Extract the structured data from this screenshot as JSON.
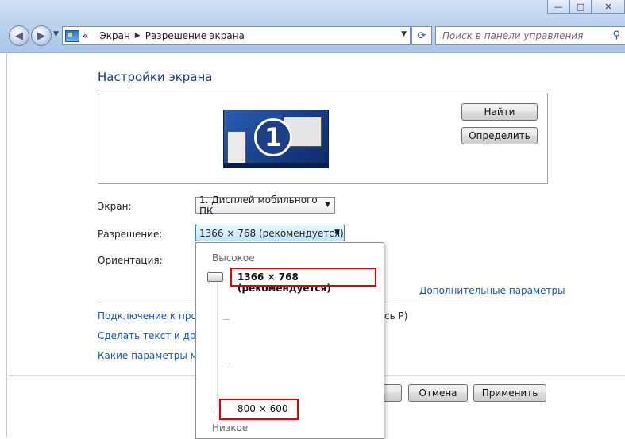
{
  "window": {
    "minimize": "—",
    "maximize": "□",
    "close": "✕"
  },
  "nav": {
    "back_icon": "back-arrow-icon",
    "forward_icon": "forward-arrow-icon"
  },
  "address": {
    "prefix": "«",
    "crumbs": [
      "Экран",
      "Разрешение экрана"
    ]
  },
  "search": {
    "placeholder": "Поиск в панели управления"
  },
  "page": {
    "title": "Настройки экрана"
  },
  "preview": {
    "monitor_number": "1"
  },
  "buttons": {
    "find": "Найти",
    "identify": "Определить",
    "cancel": "Отмена",
    "apply": "Применить"
  },
  "form": {
    "screen_label": "Экран:",
    "screen_value": "1. Дисплей мобильного ПК",
    "resolution_label": "Разрешение:",
    "resolution_value": "1366 × 768 (рекомендуется)",
    "orientation_label": "Ориентация:"
  },
  "links": {
    "advanced": "Дополнительные параметры",
    "projector": "Подключение к проек",
    "projector_tail": "сь P)",
    "text_size": "Сделать текст и други",
    "monitor_params": "Какие параметры мон"
  },
  "dropdown": {
    "high_label": "Высокое",
    "low_label": "Низкое",
    "top_option": "1366 × 768 (рекомендуется)",
    "bottom_option": "800 × 600"
  },
  "colors": {
    "accent_link": "#1c56a8",
    "title": "#1e3b7a",
    "highlight_box": "#e00000"
  }
}
